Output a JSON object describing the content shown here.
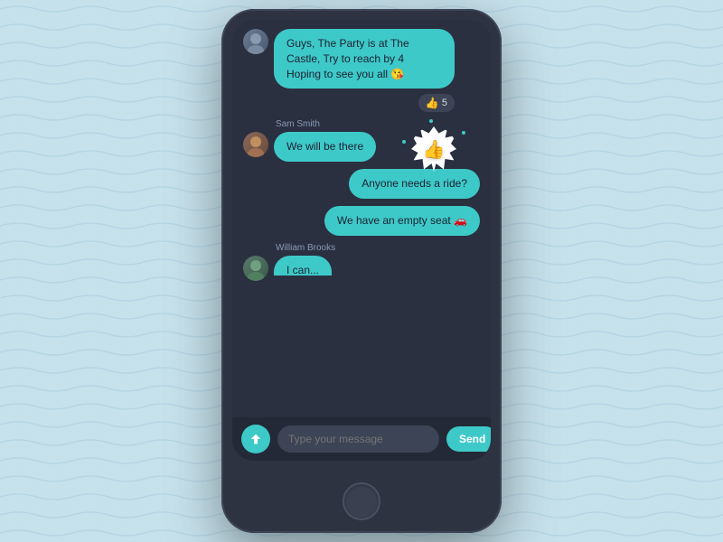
{
  "background": {
    "color": "#cfe8f0"
  },
  "chat": {
    "messages": [
      {
        "id": "msg1",
        "sender": "other",
        "text": "Guys, The Party is at The Castle, Try to reach by 4",
        "subtext": "Hoping to see you all 😘",
        "likes": 5
      },
      {
        "id": "msg2",
        "sender_name": "Sam Smith",
        "sender": "other",
        "text": "We will be there"
      },
      {
        "id": "msg3",
        "sender": "self",
        "text": "Anyone needs a ride?"
      },
      {
        "id": "msg4",
        "sender": "self",
        "text": "We have an empty seat 🚗"
      },
      {
        "id": "msg5",
        "sender_name": "William Brooks",
        "sender": "other",
        "text": "I can..."
      }
    ],
    "input_placeholder": "Type your message",
    "send_button_label": "Send"
  }
}
